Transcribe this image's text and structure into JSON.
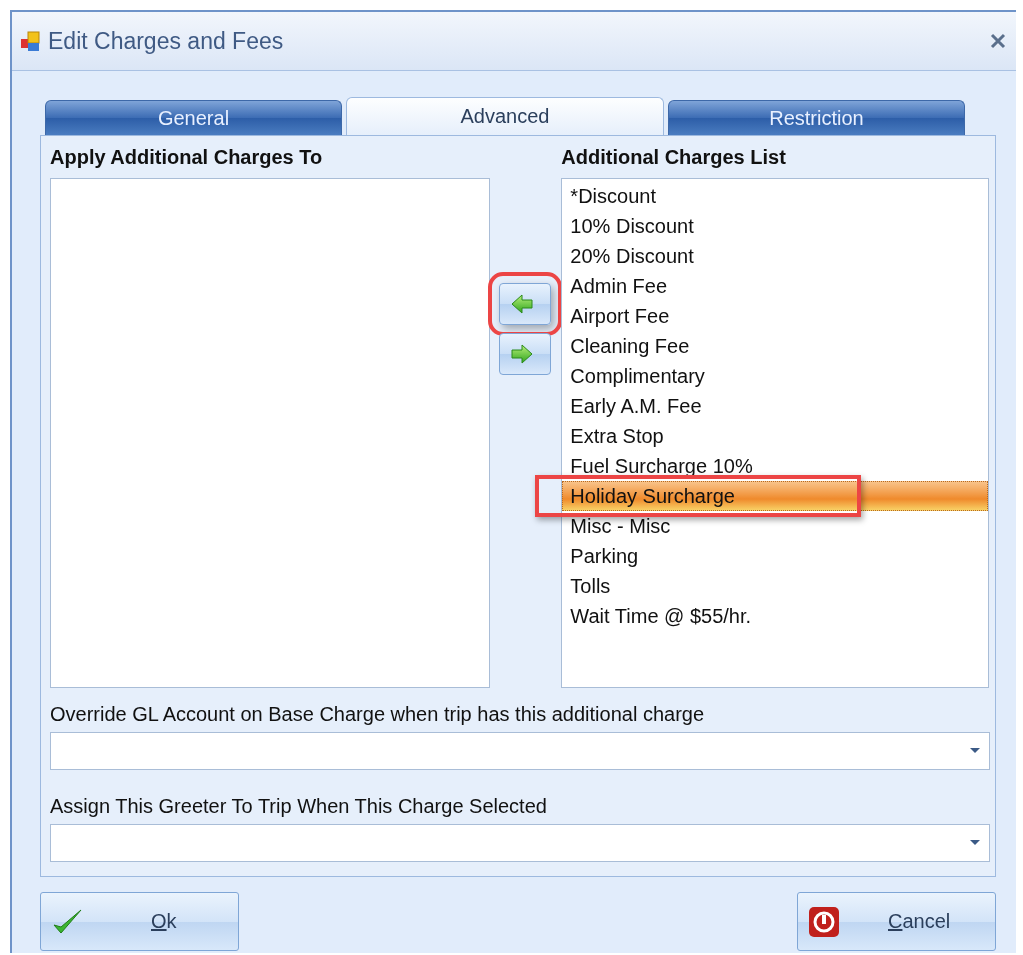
{
  "window": {
    "title": "Edit Charges and Fees"
  },
  "tabs": [
    {
      "label": "General",
      "selected": false
    },
    {
      "label": "Advanced",
      "selected": true
    },
    {
      "label": "Restriction",
      "selected": false
    }
  ],
  "left_list": {
    "heading": "Apply Additional Charges To"
  },
  "move_buttons": [
    {
      "kind": "left",
      "highlighted": true
    },
    {
      "kind": "right",
      "highlighted": false
    }
  ],
  "right_list": {
    "heading": "Additional Charges List",
    "items": [
      {
        "label": "*Discount",
        "selected": false,
        "highlighted": false
      },
      {
        "label": "10% Discount",
        "selected": false,
        "highlighted": false
      },
      {
        "label": "20% Discount",
        "selected": false,
        "highlighted": false
      },
      {
        "label": "Admin Fee",
        "selected": false,
        "highlighted": false
      },
      {
        "label": "Airport Fee",
        "selected": false,
        "highlighted": false
      },
      {
        "label": "Cleaning Fee",
        "selected": false,
        "highlighted": false
      },
      {
        "label": "Complimentary",
        "selected": false,
        "highlighted": false
      },
      {
        "label": "Early A.M. Fee",
        "selected": false,
        "highlighted": false
      },
      {
        "label": "Extra Stop",
        "selected": false,
        "highlighted": false
      },
      {
        "label": "Fuel Surcharge 10%",
        "selected": false,
        "highlighted": false
      },
      {
        "label": "Holiday Surcharge",
        "selected": true,
        "highlighted": true
      },
      {
        "label": "Misc - Misc",
        "selected": false,
        "highlighted": false
      },
      {
        "label": "Parking",
        "selected": false,
        "highlighted": false
      },
      {
        "label": "Tolls",
        "selected": false,
        "highlighted": false
      },
      {
        "label": "Wait Time @ $55/hr.",
        "selected": false,
        "highlighted": false
      }
    ]
  },
  "fields": [
    {
      "label": "Override GL Account on Base Charge when trip has this additional charge"
    },
    {
      "label": "Assign This Greeter To Trip When This Charge Selected"
    }
  ],
  "buttons": [
    {
      "kind": "ok",
      "label": "Ok",
      "access_key_underlined": true
    },
    {
      "kind": "cancel",
      "label": "Cancel",
      "access_key_underlined": true
    }
  ]
}
